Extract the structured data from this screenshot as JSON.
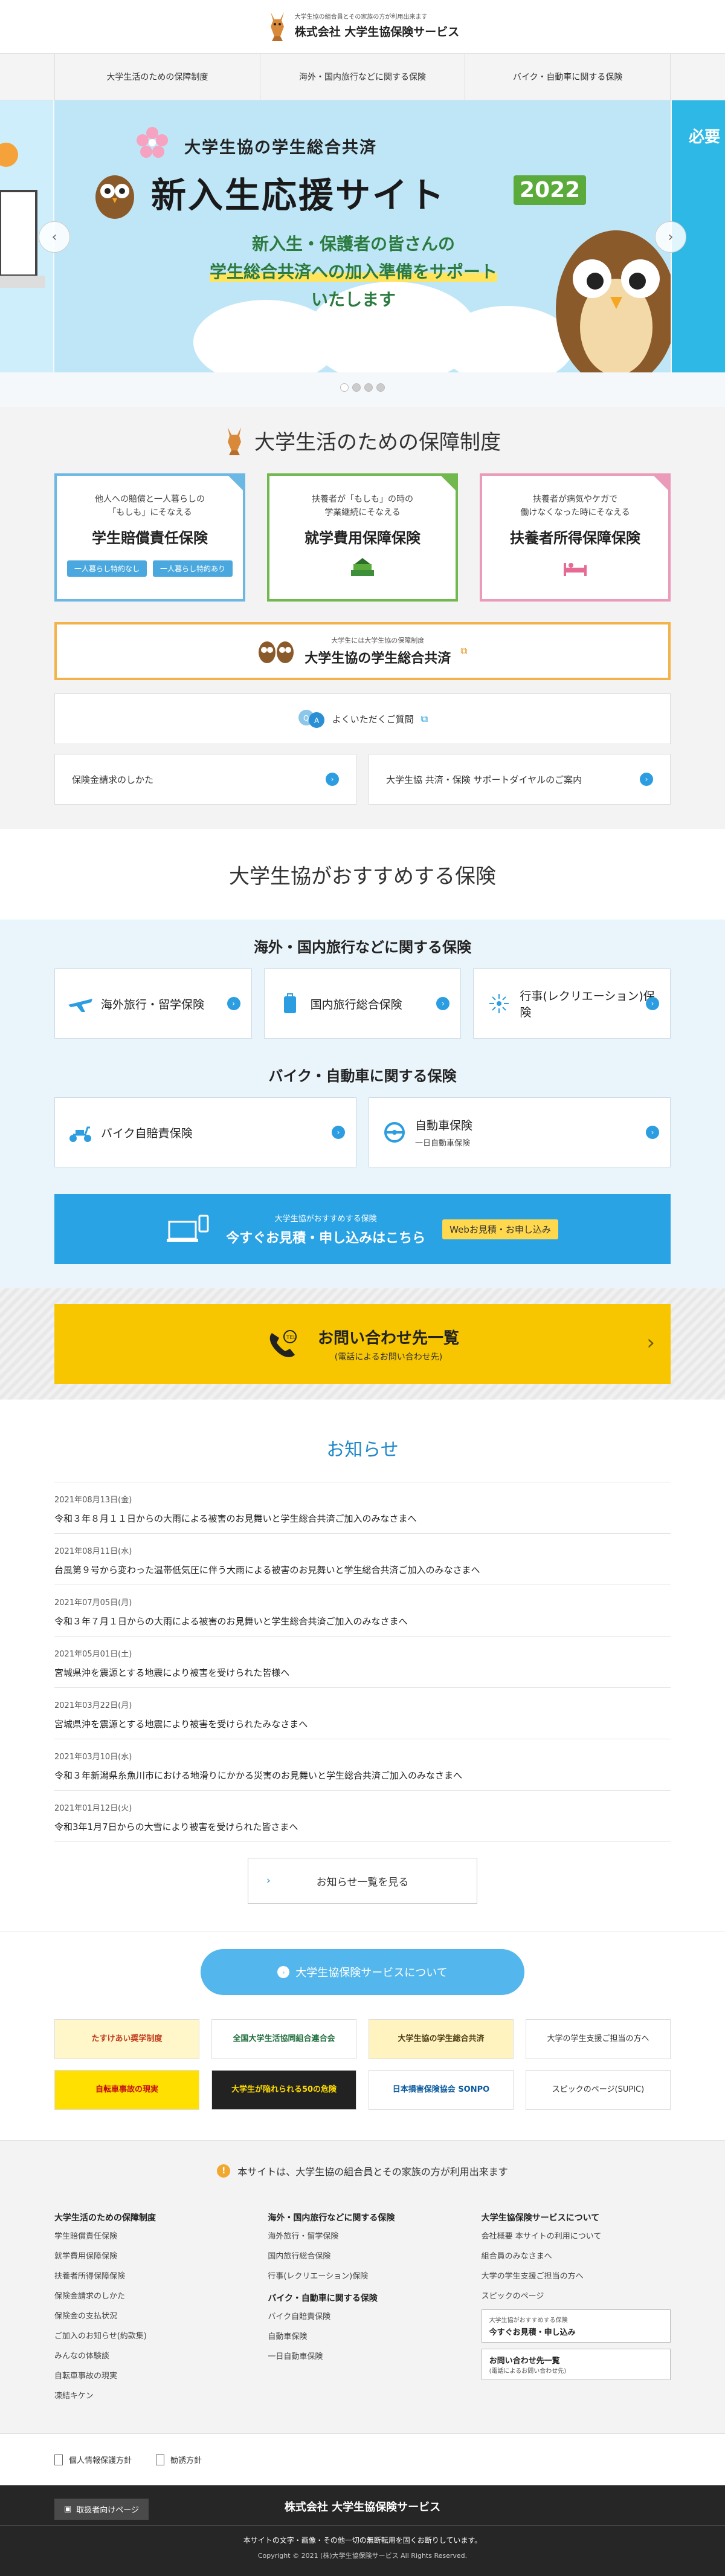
{
  "header": {
    "tagline": "大学生協の組合員とその家族の方が利用出来ます",
    "company": "株式会社 大学生協保険サービス"
  },
  "nav": {
    "items": [
      "大学生活のための保障制度",
      "海外・国内旅行などに関する保険",
      "バイク・自動車に関する保険"
    ]
  },
  "hero": {
    "sub": "大学生協の学生総合共済",
    "title": "新入生応援サイト",
    "year": "2022",
    "line1": "新入生・保護者の皆さんの",
    "line2": "学生総合共済への加入準備をサポート",
    "line3": "いたします",
    "side_text": "必要",
    "prev": "‹",
    "next": "›"
  },
  "hoshou": {
    "heading": "大学生活のための保障制度",
    "cards": [
      {
        "desc1": "他人への賠償と一人暮らしの",
        "desc2": "「もしも」にそなえる",
        "title": "学生賠償責任保険",
        "pills": [
          "一人暮らし特約なし",
          "一人暮らし特約あり"
        ]
      },
      {
        "desc1": "扶養者が「もしも」の時の",
        "desc2": "学業継続にそなえる",
        "title": "就学費用保障保険"
      },
      {
        "desc1": "扶養者が病気やケガで",
        "desc2": "働けなくなった時にそなえる",
        "title": "扶養者所得保障保険"
      }
    ],
    "kyosai_small": "大学生には大学生協の保障制度",
    "kyosai_big": "大学生協の学生総合共済",
    "faq": "よくいただくご質問",
    "links": [
      "保険金請求のしかた",
      "大学生協 共済・保険 サポートダイヤルのご案内"
    ]
  },
  "osusume": {
    "heading": "大学生協がおすすめする保険",
    "travel_h": "海外・国内旅行などに関する保険",
    "travel": [
      "海外旅行・留学保険",
      "国内旅行総合保険",
      "行事(レクリエーション)保険"
    ],
    "vehicle_h": "バイク・自動車に関する保険",
    "bike": "バイク自賠責保険",
    "car": "自動車保険",
    "car_sub": "一日自動車保険",
    "web_t1": "大学生協がおすすめする保険",
    "web_t2": "今すぐお見積・申し込みはこちら",
    "web_btn": "Webお見積・お申し込み"
  },
  "contact": {
    "title": "お問い合わせ先一覧",
    "sub": "(電話によるお問い合わせ先)"
  },
  "news": {
    "heading": "お知らせ",
    "items": [
      {
        "date": "2021年08月13日(金)",
        "title": "令和３年８月１１日からの大雨による被害のお見舞いと学生総合共済ご加入のみなさまへ"
      },
      {
        "date": "2021年08月11日(水)",
        "title": "台風第９号から変わった温帯低気圧に伴う大雨による被害のお見舞いと学生総合共済ご加入のみなさまへ"
      },
      {
        "date": "2021年07月05日(月)",
        "title": "令和３年７月１日からの大雨による被害のお見舞いと学生総合共済ご加入のみなさまへ"
      },
      {
        "date": "2021年05月01日(土)",
        "title": "宮城県沖を震源とする地震により被害を受けられた皆様へ"
      },
      {
        "date": "2021年03月22日(月)",
        "title": "宮城県沖を震源とする地震により被害を受けられたみなさまへ"
      },
      {
        "date": "2021年03月10日(水)",
        "title": "令和３年新潟県糸魚川市における地滑りにかかる災害のお見舞いと学生総合共済ご加入のみなさまへ"
      },
      {
        "date": "2021年01月12日(火)",
        "title": "令和3年1月7日からの大雪により被害を受けられた皆さまへ"
      }
    ],
    "more": "お知らせ一覧を見る"
  },
  "about": {
    "label": "大学生協保険サービスについて"
  },
  "banners": [
    "たすけあい奨学制度",
    "全国大学生活協同組合連合会",
    "大学生協の学生総合共済",
    "大学の学生支援ご担当の方へ",
    "自転車事故の現実",
    "大学生が陥れられる50の危険",
    "日本損害保険協会 SONPO",
    "スピックのページ(SUPIC)"
  ],
  "footer": {
    "note": "本サイトは、大学生協の組合員とその家族の方が利用出来ます",
    "col1_h": "大学生活のための保障制度",
    "col1": [
      "学生賠償責任保険",
      "就学費用保障保険",
      "扶養者所得保障保険",
      "保険金請求のしかた",
      "保険金の支払状況",
      "ご加入のお知らせ(約款集)",
      "みんなの体験談",
      "自転車事故の現実",
      "凍結キケン"
    ],
    "col2_h": "海外・国内旅行などに関する保険",
    "col2": [
      "海外旅行・留学保険",
      "国内旅行総合保険",
      "行事(レクリエーション)保険"
    ],
    "col2b_h": "バイク・自動車に関する保険",
    "col2b": [
      "バイク自賠責保険",
      "自動車保険",
      "一日自動車保険"
    ],
    "col3_h": "大学生協保険サービスについて",
    "col3": [
      "会社概要 本サイトの利用について",
      "組合員のみなさまへ",
      "大学の学生支援ご担当の方へ",
      "スピックのページ"
    ],
    "box1_s": "大学生協がおすすめする保険",
    "box1_b": "今すぐお見積・申し込み",
    "box2_b": "お問い合わせ先一覧",
    "box2_s": "(電話によるお問い合わせ先)",
    "privacy": "個人情報保護方針",
    "solicit": "勧誘方針",
    "agency": "取扱者向けページ",
    "company": "株式会社 大学生協保険サービス",
    "copy1": "本サイトの文字・画像・その他一切の無断転用を固くお断りしています。",
    "copy2": "Copyright © 2021 (株)大学生協保険サービス All Rights Reserved."
  }
}
